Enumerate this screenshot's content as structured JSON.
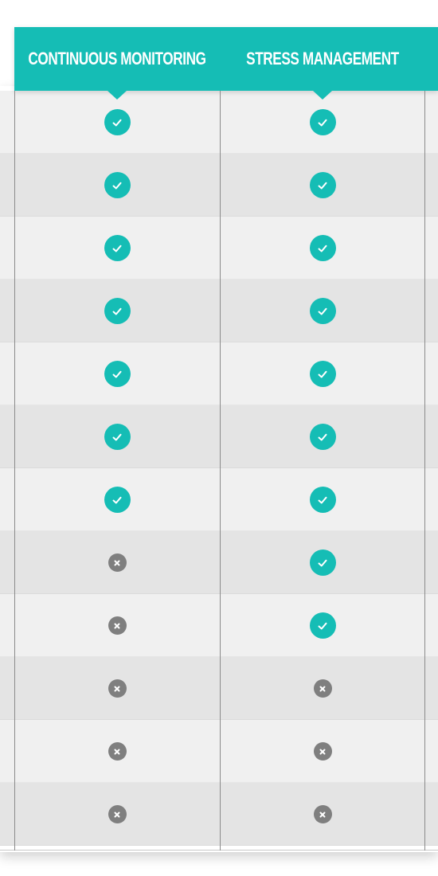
{
  "columns": [
    {
      "label": "CONTINUOUS MONITORING"
    },
    {
      "label": "STRESS MANAGEMENT"
    }
  ],
  "rows": [
    {
      "cells": [
        "check",
        "check"
      ]
    },
    {
      "cells": [
        "check",
        "check"
      ]
    },
    {
      "cells": [
        "check",
        "check"
      ]
    },
    {
      "cells": [
        "check",
        "check"
      ]
    },
    {
      "cells": [
        "check",
        "check"
      ]
    },
    {
      "cells": [
        "check",
        "check"
      ]
    },
    {
      "cells": [
        "check",
        "check"
      ]
    },
    {
      "cells": [
        "cross",
        "check"
      ]
    },
    {
      "cells": [
        "cross",
        "check"
      ]
    },
    {
      "cells": [
        "cross",
        "cross"
      ]
    },
    {
      "cells": [
        "cross",
        "cross"
      ]
    },
    {
      "cells": [
        "cross",
        "cross"
      ]
    }
  ],
  "icons": {
    "check": "check-circle-icon",
    "cross": "x-circle-icon"
  },
  "colors": {
    "accent": "#15bdb5",
    "cross": "#7f7f7f",
    "row_light": "#f0f0f0",
    "row_dark": "#e4e4e4"
  }
}
